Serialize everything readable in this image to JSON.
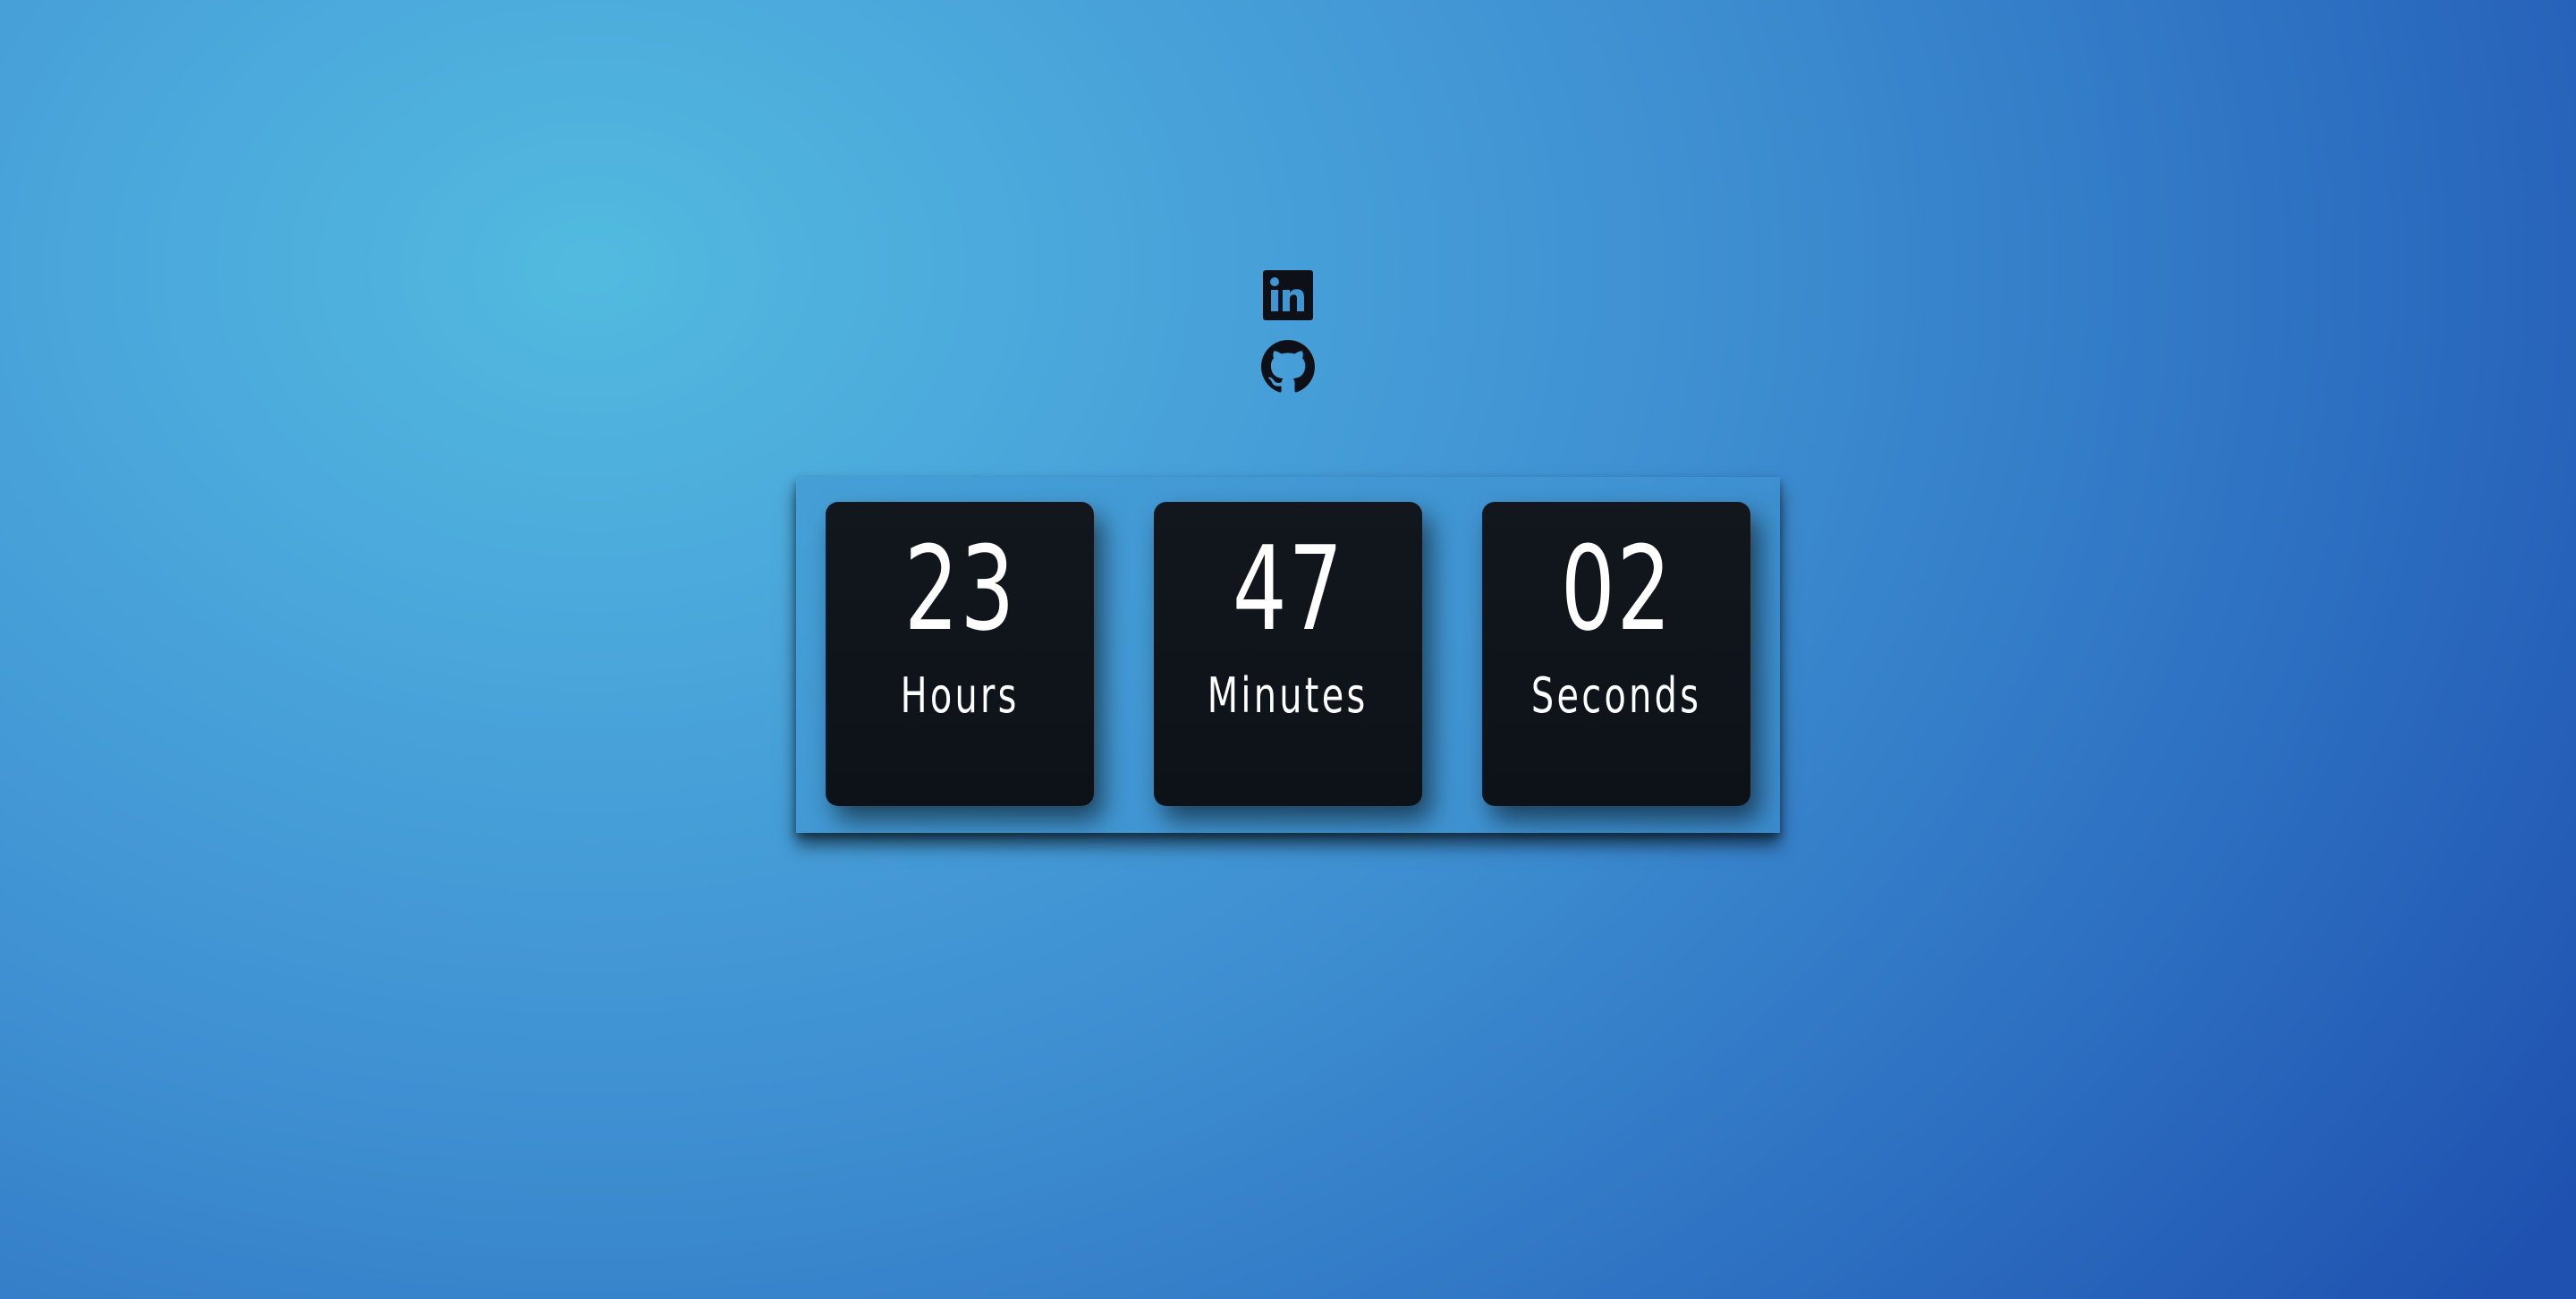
{
  "social": {
    "linkedin_icon": "linkedin-icon",
    "github_icon": "github-icon",
    "icon_color": "#0d1117"
  },
  "countdown": {
    "units": [
      {
        "value": "23",
        "label": "Hours"
      },
      {
        "value": "47",
        "label": "Minutes"
      },
      {
        "value": "02",
        "label": "Seconds"
      }
    ]
  },
  "colors": {
    "tile_background": "#0e141a",
    "text": "#ffffff",
    "background_light": "#52badf",
    "background_dark": "#1f52b0"
  }
}
